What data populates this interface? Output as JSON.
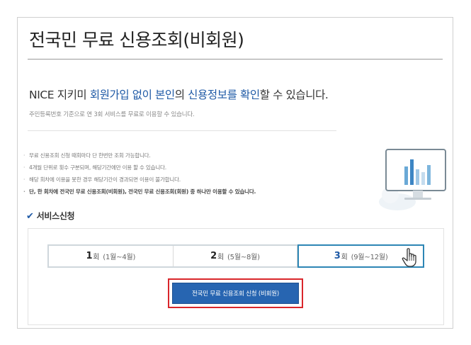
{
  "page": {
    "title": "전국민 무료 신용조회(비회원)"
  },
  "intro": {
    "prefix": "NICE 지키미 ",
    "highlight1": "회원가입 없이 본인",
    "mid1": "의 ",
    "highlight2": "신용정보를 확인",
    "suffix": "할 수 있습니다.",
    "subline": "주민등록번호 기준으로 연 3회 서비스를 무료로 이용할 수 있습니다."
  },
  "notes": [
    "무료 신용조회 신청 때회마다 단 한번만 조회 가능합니다.",
    "4개월 단위로 횟수 구분되며, 해당기간에만 이용 할 수 있습니다.",
    "해당 회차에 이용을 못한 경우 해당기간이 경과되면 이용이 불가합니다.",
    "단, 한 회차에 전국민 무료 신용조회(비회원), 전국민 무료 신용조회(회원) 중 하나만 이용할 수 있습니다."
  ],
  "service": {
    "title": "서비스신청",
    "tabs": [
      {
        "num": "1",
        "suffix": "회",
        "period": "(1월~4월)"
      },
      {
        "num": "2",
        "suffix": "회",
        "period": "(5월~8월)"
      },
      {
        "num": "3",
        "suffix": "회",
        "period": "(9월~12월)"
      }
    ],
    "active_tab": 3,
    "apply_label": "전국민 무료 신용조회 신청 (비회원)"
  },
  "colors": {
    "highlight": "#1f5aa6",
    "button": "#2765b1",
    "active_tab_border": "#2d86b5",
    "annotation_box": "#d9262b"
  },
  "icons": [
    "check-icon",
    "monitor-chart-illustration",
    "hand-pointer-cursor-icon"
  ]
}
